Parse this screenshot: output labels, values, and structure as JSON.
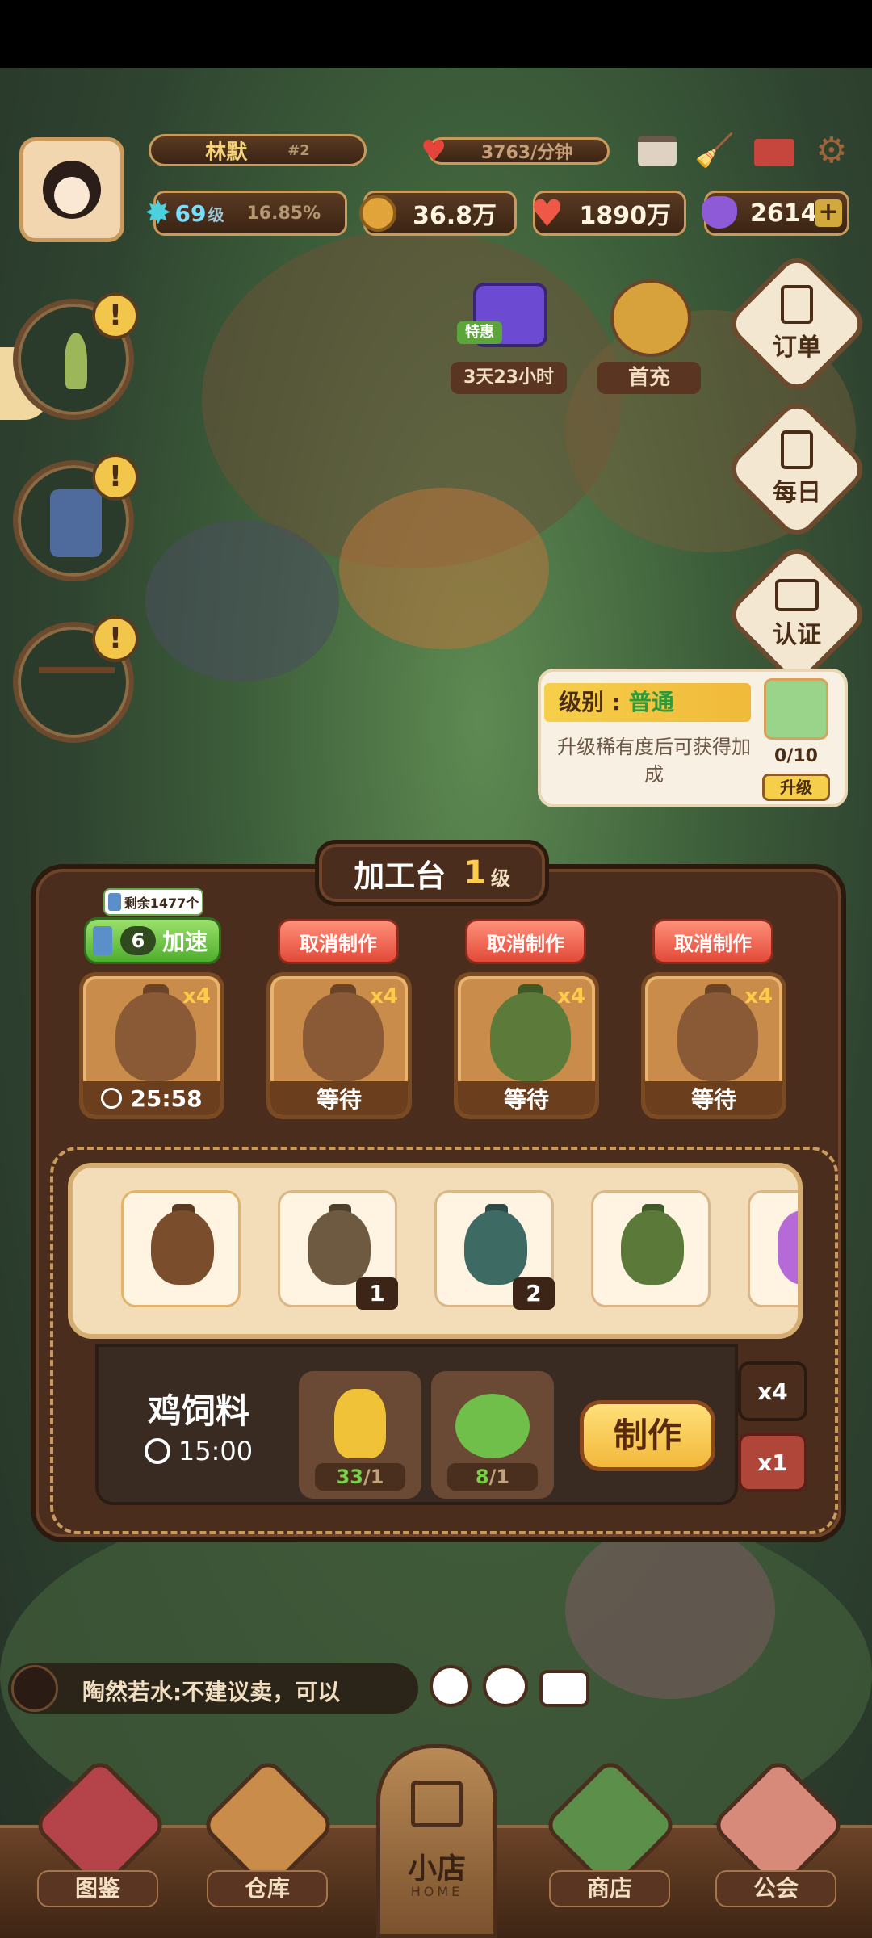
{
  "player": {
    "name": "林默",
    "rank": "#2",
    "level": "69",
    "level_unit": "级",
    "exp_percent": "16.85%",
    "rate": "3763/分钟"
  },
  "currencies": {
    "coins": "36.8万",
    "hearts": "1890万",
    "gems": "2614",
    "add": "+"
  },
  "events": {
    "gift_tag": "特惠",
    "gift_timer": "3天23小时",
    "first_recharge": "首充"
  },
  "side_buttons": [
    {
      "label": "订单"
    },
    {
      "label": "每日"
    },
    {
      "label": "认证"
    }
  ],
  "level_popup": {
    "title_prefix": "级别 : ",
    "title_value": "普通",
    "desc": "升级稀有度后可获得加成",
    "progress": "0/10",
    "upgrade_label": "升级"
  },
  "workbench": {
    "title": "加工台",
    "level": "1",
    "level_unit": "级",
    "remaining_label": "剩余1477个",
    "speedup_count": "6",
    "speedup_label": "加速",
    "cancel_label": "取消制作",
    "queue": [
      {
        "count": "x4",
        "status": "25:58",
        "sack": "#8a5a36",
        "animal": "chicken"
      },
      {
        "count": "x4",
        "status": "等待",
        "sack": "#8a5a36",
        "animal": "chicken"
      },
      {
        "count": "x4",
        "status": "等待",
        "sack": "#5c7a3a",
        "animal": "crab"
      },
      {
        "count": "x4",
        "status": "等待",
        "sack": "#8a5a36",
        "animal": "cow"
      }
    ],
    "recipes": [
      {
        "badge": "",
        "sack": "#7a4e2c"
      },
      {
        "badge": "1",
        "sack": "#6e5a40"
      },
      {
        "badge": "2",
        "sack": "#3e6a64"
      },
      {
        "badge": "",
        "sack": "#5b7a3a"
      }
    ],
    "selected": {
      "name": "鸡饲料",
      "time": "15:00"
    },
    "materials": [
      {
        "have": "33",
        "need": "/1",
        "item": "wheat"
      },
      {
        "have": "8",
        "need": "/1",
        "item": "cabbage"
      }
    ],
    "craft_label": "制作",
    "multipliers": [
      "x4",
      "x1"
    ]
  },
  "chat": {
    "message": "陶然若水:不建议卖，可以"
  },
  "nav": {
    "items": [
      "图鉴",
      "仓库",
      "商店",
      "公会"
    ],
    "home": "小店",
    "home_sub": "HOME"
  },
  "colors": {
    "accent_gold": "#ffcc4a",
    "cancel_red": "#e24a3a",
    "green": "#79d04a",
    "panel_brown": "#4a2d1c"
  }
}
